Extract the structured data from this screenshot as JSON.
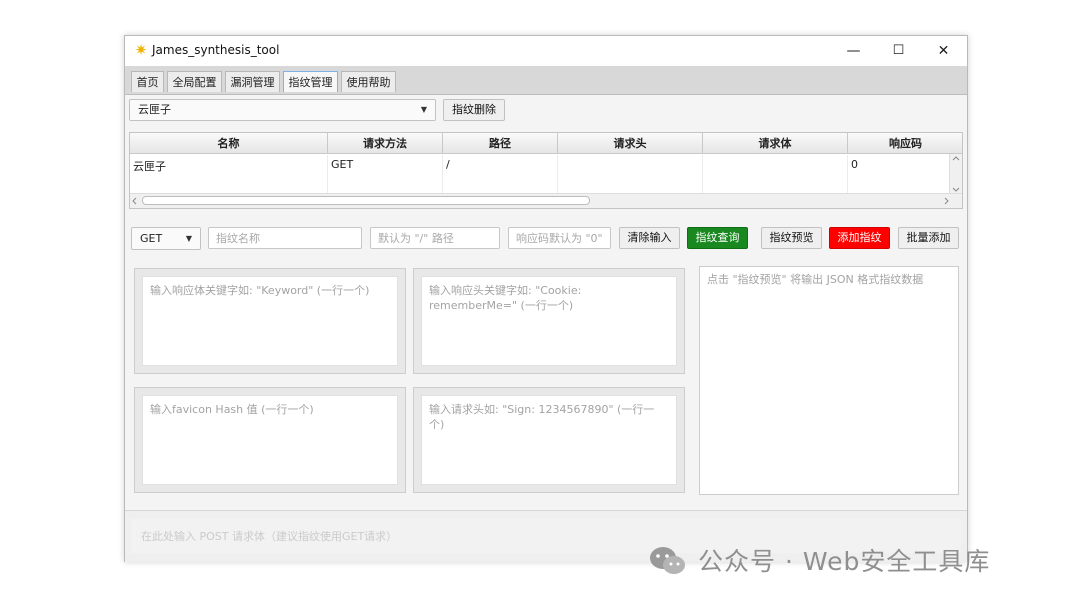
{
  "window": {
    "title": "James_synthesis_tool",
    "minimize": "—",
    "maximize": "☐",
    "close": "✕"
  },
  "tabs": [
    {
      "label": "首页"
    },
    {
      "label": "全局配置"
    },
    {
      "label": "漏洞管理"
    },
    {
      "label": "指纹管理"
    },
    {
      "label": "使用帮助"
    }
  ],
  "fingerprint_select": {
    "value": "云匣子",
    "arrow": "▼"
  },
  "delete_button": "指纹删除",
  "table": {
    "headers": [
      "名称",
      "请求方法",
      "路径",
      "请求头",
      "请求体",
      "响应码"
    ],
    "rows": [
      [
        "云匣子",
        "GET",
        "/",
        "",
        "",
        "0"
      ]
    ]
  },
  "form": {
    "method": "GET",
    "method_arrow": "▼",
    "name_placeholder": "指纹名称",
    "path_placeholder": "默认为 \"/\" 路径",
    "code_placeholder": "响应码默认为 \"0\"",
    "clear_button": "清除输入",
    "query_button": "指纹查询",
    "preview_button": "指纹预览",
    "add_button": "添加指纹",
    "batch_button": "批量添加"
  },
  "panels": {
    "body_keyword": "输入响应体关键字如: \"Keyword\" (一行一个)",
    "header_keyword": "输入响应头关键字如: \"Cookie: rememberMe=\" (一行一个)",
    "favicon": "输入favicon Hash 值 (一行一个)",
    "request_header": "输入请求头如: \"Sign: 1234567890\" (一行一个)",
    "preview": "点击 \"指纹预览\" 将输出 JSON 格式指纹数据"
  },
  "post_body_placeholder": "在此处输入 POST 请求体（建议指纹使用GET请求）",
  "watermark": "公众号 · Web安全工具库",
  "colors": {
    "green": "#18881f",
    "red": "#ff0000",
    "accent": "#7fb2e5"
  }
}
